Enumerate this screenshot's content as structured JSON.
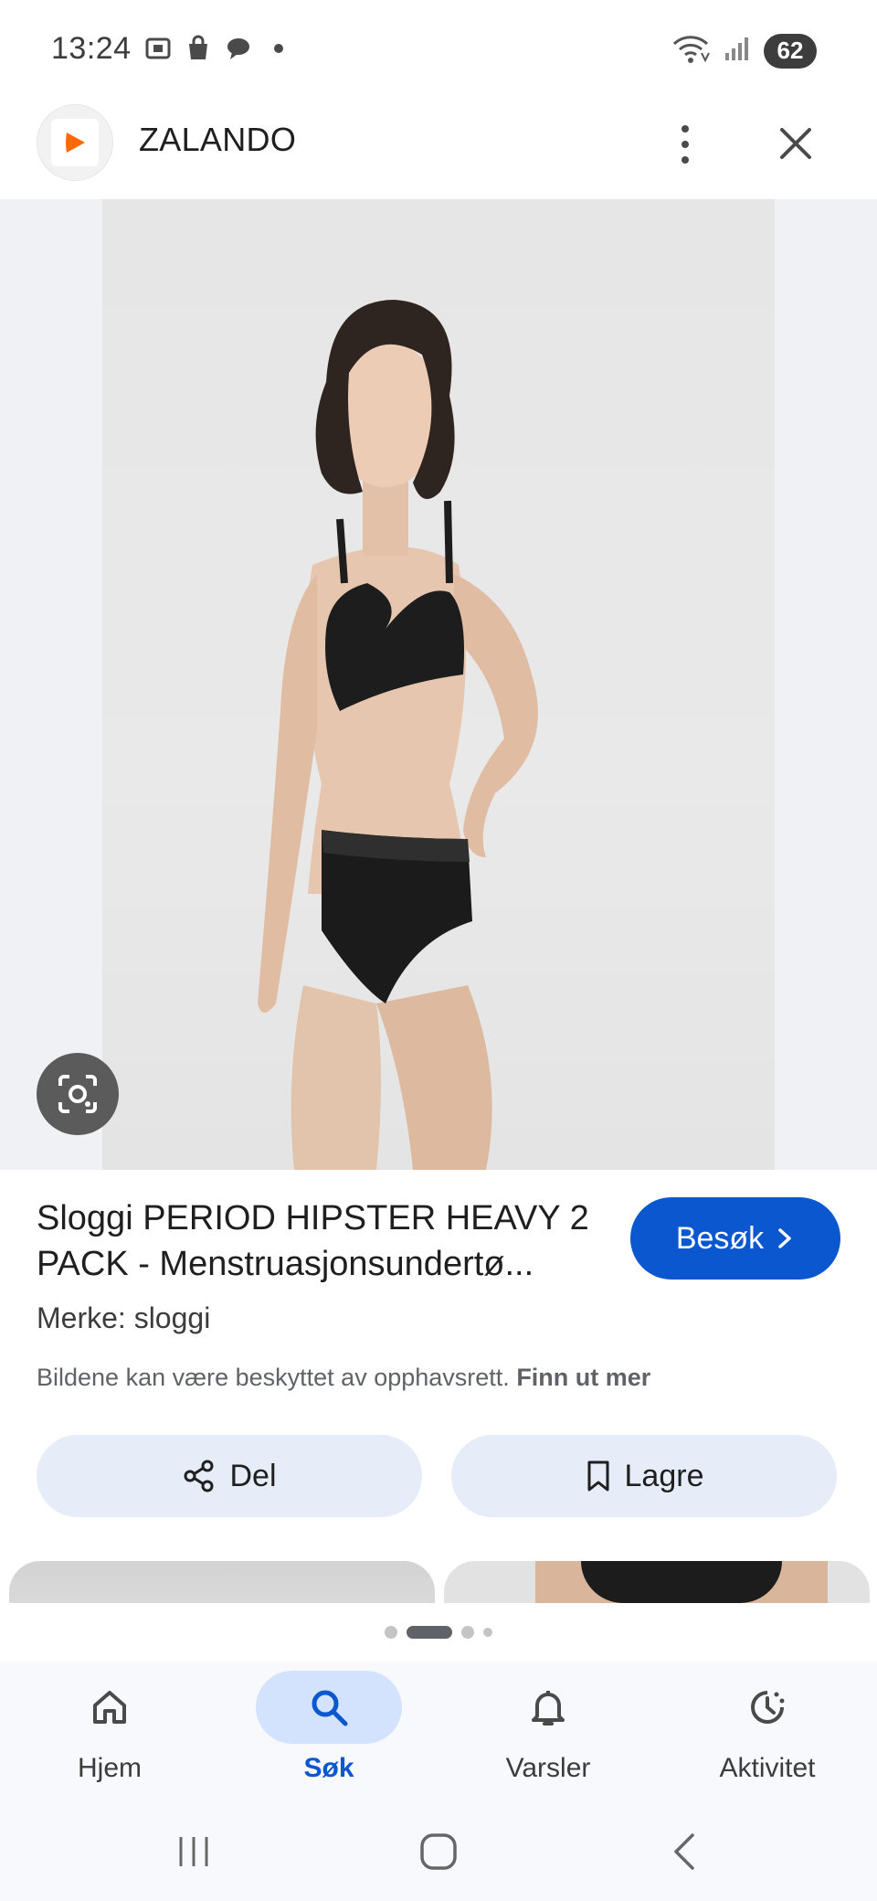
{
  "status_bar": {
    "time": "13:24",
    "battery": "62"
  },
  "header": {
    "site_name": "ZALANDO",
    "favicon_color": "#ff6900"
  },
  "product": {
    "title": "Sloggi PERIOD HIPSTER HEAVY 2 PACK - Menstruasjonsundertø...",
    "visit_label": "Besøk",
    "brand": "Merke: sloggi",
    "copyright_notice": "Bildene kan være beskyttet av opphavsrett.",
    "learn_more": "Finn ut mer"
  },
  "actions": {
    "share_label": "Del",
    "save_label": "Lagre"
  },
  "bottom_nav": {
    "items": [
      {
        "label": "Hjem",
        "icon": "home-icon",
        "active": false
      },
      {
        "label": "Søk",
        "icon": "search-icon",
        "active": true
      },
      {
        "label": "Varsler",
        "icon": "bell-icon",
        "active": false
      },
      {
        "label": "Aktivitet",
        "icon": "activity-icon",
        "active": false
      }
    ]
  },
  "colors": {
    "accent": "#0b57d0",
    "chip_bg": "#e6ecf8",
    "active_nav_bg": "#d3e3fd"
  }
}
